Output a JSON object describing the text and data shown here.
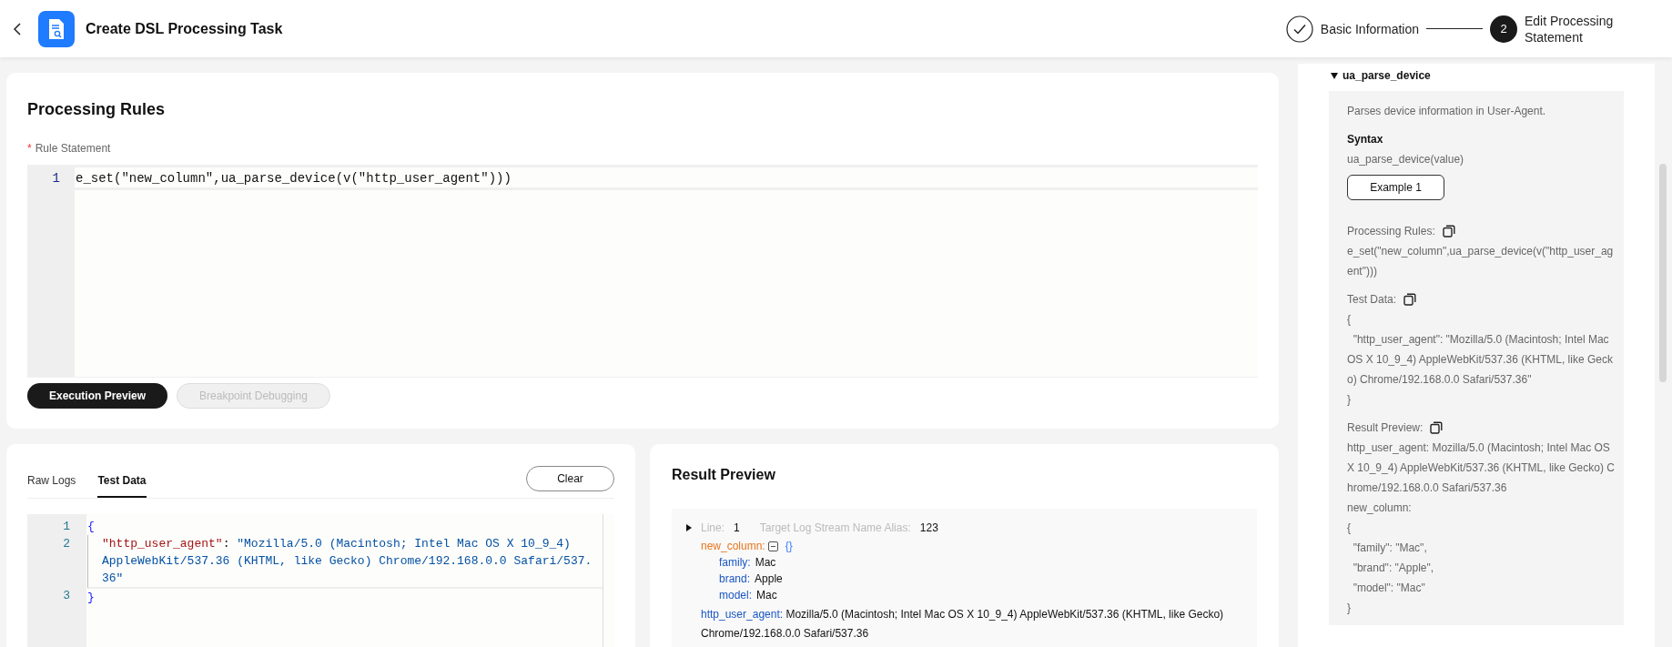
{
  "header": {
    "title": "Create DSL Processing Task",
    "steps": [
      {
        "label": "Basic Information",
        "completed": true
      },
      {
        "number": "2",
        "label": "Edit Processing Statement",
        "completed": false
      }
    ]
  },
  "processing_rules": {
    "title": "Processing Rules",
    "required_mark": "*",
    "label": "Rule Statement",
    "editor_lines": [
      {
        "number": "1",
        "text": "e_set(\"new_column\",ua_parse_device(v(\"http_user_agent\")))"
      }
    ],
    "buttons": [
      {
        "label": "Execution Preview",
        "disabled": false
      },
      {
        "label": "Breakpoint Debugging",
        "disabled": true
      }
    ]
  },
  "test_panel": {
    "tabs": [
      {
        "label": "Raw Logs",
        "selected": false
      },
      {
        "label": "Test Data",
        "selected": true
      }
    ],
    "clear_button": "Clear",
    "code_lines": [
      {
        "number": "1",
        "kind": "brace",
        "text": "{"
      },
      {
        "number": "2",
        "kind": "pair",
        "key": "\"http_user_agent\"",
        "sep": ":",
        "value_rows": [
          "\"Mozilla/5.0 (Macintosh; Intel Mac OS X 10_9_4)",
          "AppleWebKit/537.36 (KHTML, like Gecko) Chrome/192.168.0.0 Safari/537.",
          "36\""
        ]
      },
      {
        "number": "3",
        "kind": "brace",
        "text": "}"
      }
    ]
  },
  "result_preview": {
    "title": "Result Preview",
    "line_label": "Line:",
    "line_value": "1",
    "alias_label": "Target Log Stream Name Alias:",
    "alias_value": "123",
    "object_key": "new_column:",
    "object_brace": "{}",
    "expanded": true,
    "fields": [
      {
        "key": "family:",
        "value": "Mac"
      },
      {
        "key": "brand:",
        "value": "Apple"
      },
      {
        "key": "model:",
        "value": "Mac"
      }
    ],
    "agent_key": "http_user_agent:",
    "agent_value": "Mozilla/5.0 (Macintosh; Intel Mac OS X 10_9_4) AppleWebKit/537.36 (KHTML, like Gecko) Chrome/192.168.0.0 Safari/537.36"
  },
  "function_help": {
    "name": "ua_parse_device",
    "expanded": true,
    "description": "Parses device information in User-Agent.",
    "syntax_title": "Syntax",
    "syntax": "ua_parse_device(value)",
    "example_button": "Example 1",
    "sections": [
      {
        "label": "Processing Rules:",
        "lines": [
          "e_set(\"new_column\",ua_parse_device(v(\"http_user_ag",
          "ent\")))"
        ]
      },
      {
        "label": "Test Data:",
        "lines": [
          "{",
          "  \"http_user_agent\": \"Mozilla/5.0 (Macintosh; Intel Mac",
          "OS X 10_9_4) AppleWebKit/537.36 (KHTML, like Geck",
          "o) Chrome/192.168.0.0 Safari/537.36\"",
          "}"
        ]
      },
      {
        "label": "Result Preview:",
        "lines": [
          "http_user_agent: Mozilla/5.0 (Macintosh; Intel Mac OS",
          "X 10_9_4) AppleWebKit/537.36 (KHTML, like Gecko) C",
          "hrome/192.168.0.0 Safari/537.36",
          "new_column:",
          "{",
          "  \"family\": \"Mac\",",
          "  \"brand\": \"Apple\",",
          "  \"model\": \"Mac\"",
          "}"
        ]
      }
    ]
  }
}
